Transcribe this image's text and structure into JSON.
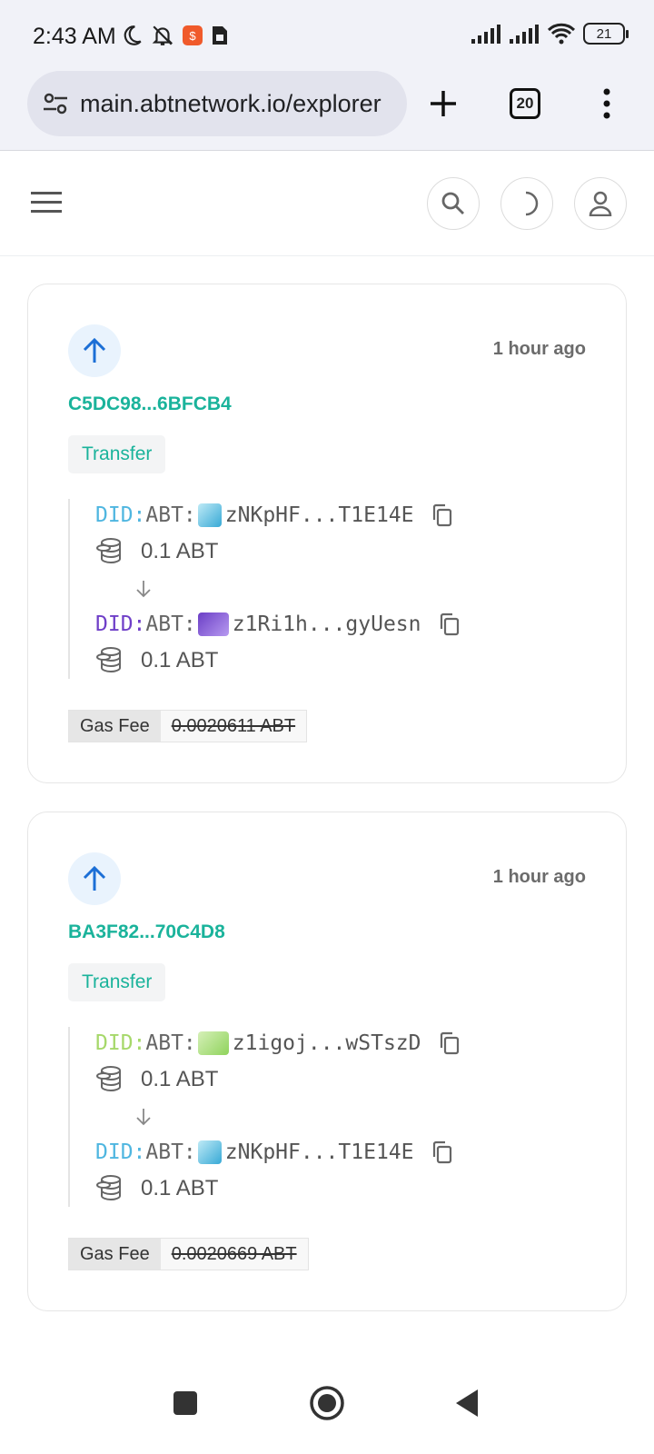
{
  "status_bar": {
    "time": "2:43 AM",
    "battery": "21"
  },
  "browser": {
    "url": "main.abtnetwork.io/explorer",
    "tab_count": "20"
  },
  "transactions": [
    {
      "time": "1 hour ago",
      "hash": "C5DC98...6BFCB4",
      "type": "Transfer",
      "from": {
        "did_prefix": "DID:",
        "chain": "ABT:",
        "address": "zNKpHF...T1E14E",
        "did_color": "#4fb6e0",
        "avatar_color": "#55c6e8",
        "amount": "0.1 ABT"
      },
      "to": {
        "did_prefix": "DID:",
        "chain": "ABT:",
        "address": "z1Ri1h...gyUesn",
        "did_color": "#6f3fc8",
        "avatar_color": "#8a5bdc",
        "amount": "0.1 ABT"
      },
      "gas_label": "Gas Fee",
      "gas_value": "0.0020611 ABT"
    },
    {
      "time": "1 hour ago",
      "hash": "BA3F82...70C4D8",
      "type": "Transfer",
      "from": {
        "did_prefix": "DID:",
        "chain": "ABT:",
        "address": "z1igoj...wSTszD",
        "did_color": "#a6d86a",
        "avatar_color": "#b4e48a",
        "amount": "0.1 ABT"
      },
      "to": {
        "did_prefix": "DID:",
        "chain": "ABT:",
        "address": "zNKpHF...T1E14E",
        "did_color": "#4fb6e0",
        "avatar_color": "#55c6e8",
        "amount": "0.1 ABT"
      },
      "gas_label": "Gas Fee",
      "gas_value": "0.0020669 ABT"
    }
  ]
}
